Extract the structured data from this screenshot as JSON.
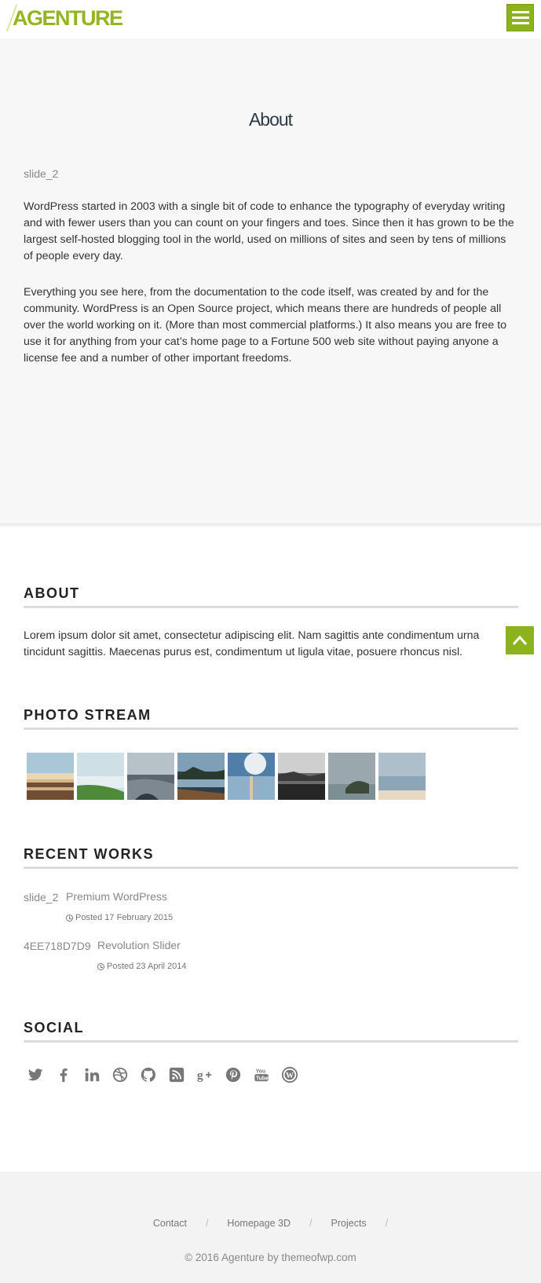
{
  "header": {
    "logo_text": "AGENTURE",
    "menu_icon": "hamburger-menu-icon"
  },
  "main": {
    "title": "About",
    "slide_label": "slide_2",
    "paragraphs": [
      "WordPress started in 2003 with a single bit of code to enhance the typography of everyday writing and with fewer users than you can count on your fingers and toes. Since then it has grown to be the largest self-hosted blogging tool in the world, used on millions of sites and seen by tens of millions of people every day.",
      "Everything you see here, from the documentation to the code itself, was created by and for the community. WordPress is an Open Source project, which means there are hundreds of people all over the world working on it. (More than most commercial platforms.) It also means you are free to use it for anything from your cat’s home page to a Fortune 500 web site without paying anyone a license fee and a number of other important freedoms."
    ]
  },
  "about_widget": {
    "title": "ABOUT",
    "text": "Lorem ipsum dolor sit amet, consectetur adipiscing elit. Nam sagittis ante condimentum urna tincidunt sagittis. Maecenas purus est, condimentum ut ligula vitae, posuere rhoncus nisl."
  },
  "photo_stream": {
    "title": "PHOTO STREAM"
  },
  "recent_works": {
    "title": "RECENT WORKS",
    "items": [
      {
        "thumb_label": "slide_2",
        "title": "Premium WordPress",
        "date": "Posted 17 February 2015"
      },
      {
        "thumb_label": "4EE718D7D9",
        "title": "Revolution Slider",
        "date": "Posted 23 April 2014"
      }
    ]
  },
  "social": {
    "title": "SOCIAL",
    "icons": [
      "twitter-icon",
      "facebook-icon",
      "linkedin-icon",
      "dribbble-icon",
      "github-icon",
      "rss-icon",
      "google-plus-icon",
      "pinterest-icon",
      "youtube-icon",
      "wordpress-icon"
    ]
  },
  "footer": {
    "links": [
      "Contact",
      "Homepage 3D",
      "Projects"
    ],
    "separator": "/",
    "copyright": "© 2016 Agenture by themeofwp.com"
  },
  "colors": {
    "accent": "#8db31c",
    "logo": "#94b521",
    "main_bg": "#f7f7f7",
    "footer_bg": "#f3f3f3"
  }
}
